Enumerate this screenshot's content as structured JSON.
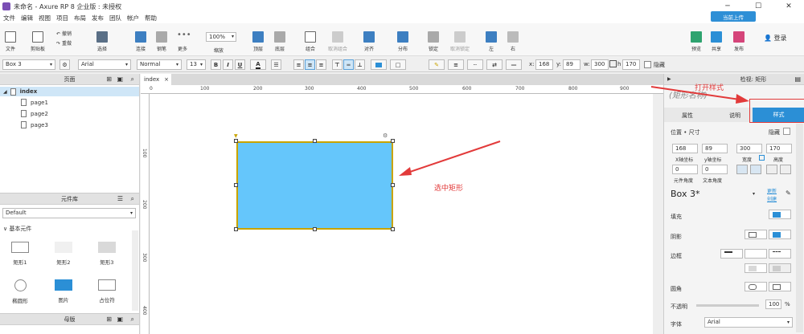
{
  "window": {
    "title": "未命名 - Axure RP 8 企业版 : 未授权",
    "minimize": "─",
    "maximize": "☐",
    "close": "✕"
  },
  "menu": [
    "文件",
    "编辑",
    "视图",
    "项目",
    "布局",
    "发布",
    "团队",
    "帐户",
    "帮助"
  ],
  "share_top_label": "当前上传",
  "toolbar": {
    "file": "文件",
    "clipboard": "剪贴板",
    "undo": "撤销",
    "redo": "重做",
    "select": "选择",
    "connect": "连接",
    "pen": "钢笔",
    "more": "更多",
    "zoom_value": "100%",
    "zoom_label": "缩放",
    "top": "顶层",
    "bottom": "底层",
    "group": "组合",
    "ungroup": "取消组合",
    "align": "对齐",
    "distribute": "分布",
    "lock": "锁定",
    "unlock": "取消锁定",
    "left": "左",
    "right": "右",
    "preview": "预览",
    "share": "共享",
    "publish": "发布",
    "login": "登录"
  },
  "stylebar": {
    "widget_name": "Box 3",
    "font": "Arial",
    "weight": "Normal",
    "size": "13",
    "bold": "B",
    "italic": "I",
    "underline": "U",
    "x_label": "x:",
    "x": "168",
    "y_label": "y:",
    "y": "89",
    "w_label": "w:",
    "w": "300",
    "h_label": "h",
    "h": "170",
    "hidden_label": "隐藏"
  },
  "pages": {
    "title": "页面",
    "items": [
      "index",
      "page1",
      "page2",
      "page3"
    ]
  },
  "library": {
    "title": "元件库",
    "selected": "Default",
    "group": "基本元件",
    "items": [
      "矩形1",
      "矩形2",
      "矩形3",
      "椭圆形",
      "图片",
      "占位符"
    ]
  },
  "masters": {
    "title": "母版"
  },
  "canvas": {
    "tab": "index",
    "ruler_h": [
      "0",
      "100",
      "200",
      "300",
      "400",
      "500",
      "600",
      "700",
      "800",
      "900"
    ],
    "ruler_v": [
      "100",
      "200",
      "300",
      "400"
    ],
    "rect_fill": "#65c6fb",
    "rect_border": "#c9a400"
  },
  "inspector": {
    "title": "检视: 矩形",
    "name_placeholder": "(矩形名称)",
    "tabs": [
      "属性",
      "说明",
      "样式"
    ],
    "section_pos": "位置 • 尺寸",
    "hidden": "隐藏",
    "x": "168",
    "y": "89",
    "w": "300",
    "h": "170",
    "x_label": "X轴坐标",
    "y_label": "y轴坐标",
    "w_label": "宽度",
    "h_label": "高度",
    "rot_element": "0",
    "rot_text": "0",
    "rot_element_label": "元件角度",
    "rot_text_label": "文本角度",
    "style_name": "Box 3*",
    "update": "更新",
    "create": "创建",
    "fill": "填充",
    "shadow": "阴影",
    "border": "边框",
    "radius": "圆角",
    "opacity_label": "不透明",
    "opacity": "100",
    "opacity_unit": "%",
    "font_label": "字体",
    "font": "Arial"
  },
  "annotations": {
    "open_style": "打开样式",
    "select_rect": "选中矩形"
  },
  "accent": "#2b8fd6",
  "annot_color": "#e23a3a"
}
